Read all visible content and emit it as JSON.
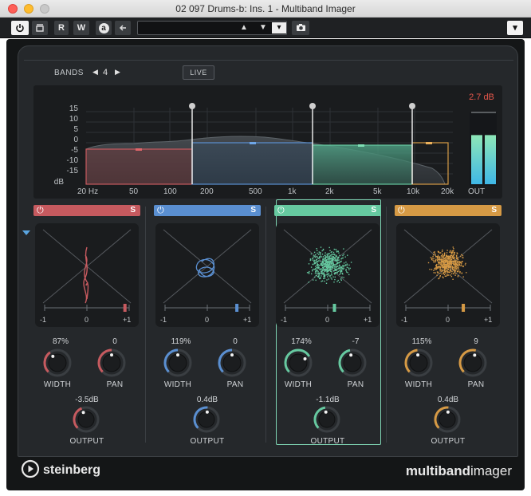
{
  "window": {
    "title": "02 097 Drums-b: Ins. 1 - Multiband Imager"
  },
  "toolbar": {
    "r_label": "R",
    "w_label": "W",
    "a_label": "a",
    "preset_dropdown": "▾",
    "menu_dropdown": "▾"
  },
  "header": {
    "bands_label": "BANDS",
    "bands_count": "4",
    "live_label": "LIVE"
  },
  "spectrum": {
    "y_ticks": [
      "15",
      "10",
      "5",
      "0",
      "-5",
      "-10",
      "-15"
    ],
    "y_unit": "dB",
    "x_ticks": [
      "20 Hz",
      "50",
      "100",
      "200",
      "500",
      "1k",
      "2k",
      "5k",
      "10k",
      "20k"
    ],
    "output_peak": "2.7 dB",
    "output_label": "OUT",
    "meter_left": 0.7,
    "meter_right": 0.7
  },
  "bands": [
    {
      "name": "band-1",
      "color": "#c65a5f",
      "width_value": "87%",
      "pan_value": "0",
      "output_value": "-3.5dB",
      "width_pos": 0.37,
      "pan_pos": 0.5,
      "output_pos": 0.42,
      "balance_pos": 0.95
    },
    {
      "name": "band-2",
      "color": "#5a8fd1",
      "width_value": "119%",
      "pan_value": "0",
      "output_value": "0.4dB",
      "width_pos": 0.5,
      "pan_pos": 0.5,
      "output_pos": 0.52,
      "balance_pos": 0.85
    },
    {
      "name": "band-3",
      "color": "#66c9a0",
      "width_value": "174%",
      "pan_value": "-7",
      "output_value": "-1.1dB",
      "width_pos": 0.72,
      "pan_pos": 0.46,
      "output_pos": 0.47,
      "balance_pos": 0.58
    },
    {
      "name": "band-4",
      "color": "#d69a45",
      "width_value": "115%",
      "pan_value": "9",
      "output_value": "0.4dB",
      "width_pos": 0.48,
      "pan_pos": 0.55,
      "output_pos": 0.52,
      "balance_pos": 0.68
    }
  ],
  "band_labels": {
    "width": "WIDTH",
    "pan": "PAN",
    "output": "OUTPUT",
    "scale_min": "-1",
    "scale_mid": "0",
    "scale_max": "+1",
    "solo": "S"
  },
  "footer": {
    "brand": "steinberg",
    "product_bold": "multiband",
    "product_light": "imager"
  },
  "colors": {
    "background": "#25282b",
    "accent_red": "#e8584c"
  }
}
